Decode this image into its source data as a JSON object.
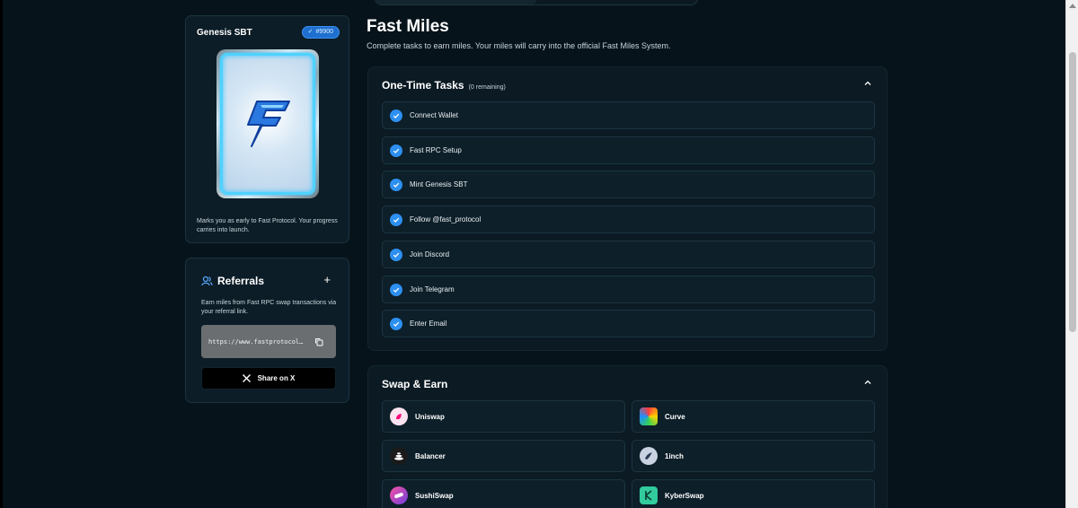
{
  "genesis": {
    "title": "Genesis SBT",
    "badge": "#9900",
    "description": "Marks you as early to Fast Protocol. Your progress carries into launch."
  },
  "referrals": {
    "title": "Referrals",
    "description": "Earn miles from Fast RPC swap transactions via your referral link.",
    "link": "https://www.fastprotocol…",
    "share_label": "Share on X"
  },
  "main": {
    "title": "Fast Miles",
    "subtitle": "Complete tasks to earn miles. Your miles will carry into the official Fast Miles System."
  },
  "one_time_tasks": {
    "title": "One-Time Tasks",
    "remaining": "(0 remaining)",
    "items": [
      {
        "label": "Connect Wallet"
      },
      {
        "label": "Fast RPC Setup"
      },
      {
        "label": "Mint Genesis SBT"
      },
      {
        "label": "Follow @fast_protocol"
      },
      {
        "label": "Join Discord"
      },
      {
        "label": "Join Telegram"
      },
      {
        "label": "Enter Email"
      }
    ]
  },
  "swap_earn": {
    "title": "Swap & Earn",
    "items": [
      {
        "label": "Uniswap"
      },
      {
        "label": "Curve"
      },
      {
        "label": "Balancer"
      },
      {
        "label": "1inch"
      },
      {
        "label": "SushiSwap"
      },
      {
        "label": "KyberSwap"
      }
    ]
  },
  "colors": {
    "background": "#07131a",
    "panel": "#0b1a23",
    "accent": "#2d8ff0"
  }
}
